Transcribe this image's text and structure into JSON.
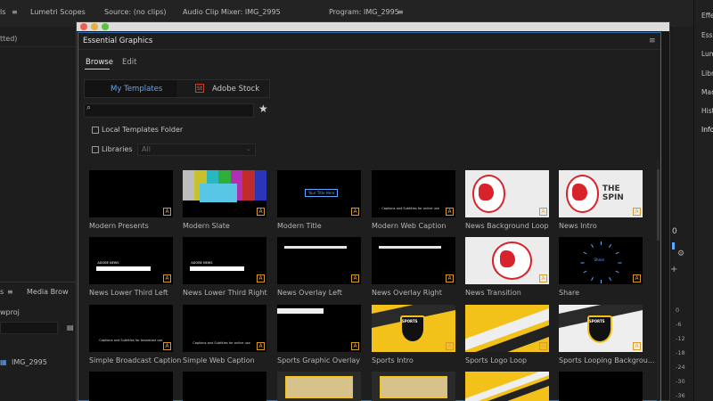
{
  "app": {
    "top_tabs": [
      "ls",
      "Lumetri Scopes",
      "Source: (no clips)",
      "Audio Clip Mixer: IMG_2995",
      "Program: IMG_2995"
    ],
    "left_text_1": "tted)",
    "right_tabs": [
      "Effe",
      "Essen",
      "Lum",
      "Libr",
      "Mar",
      "Hist",
      "Info"
    ],
    "bottom_left": {
      "tab": "Media Brow",
      "project": "wproj",
      "clip": "IMG_2995"
    },
    "meter_values": [
      "0",
      "-6",
      "-12",
      "-18",
      "-24",
      "-30",
      "-36"
    ]
  },
  "panel": {
    "title": "Essential Graphics",
    "tabs": [
      "Browse",
      "Edit"
    ],
    "segments": [
      "My Templates",
      "Adobe Stock"
    ],
    "stock_icon_text": "St",
    "search_placeholder": "",
    "local_templates_label": "Local Templates Folder",
    "libraries_label": "Libraries",
    "libraries_value": "All",
    "badge_text": "A"
  },
  "templates": [
    {
      "name": "Modern Presents",
      "style": "dark-text"
    },
    {
      "name": "Modern Slate",
      "style": "colorbars"
    },
    {
      "name": "Modern Title",
      "style": "title-box",
      "overlay": "Your Title Here"
    },
    {
      "name": "Modern Web Caption",
      "style": "caption",
      "overlay": "Captions and Subtitles for online use"
    },
    {
      "name": "News Background Loop",
      "style": "globe"
    },
    {
      "name": "News Intro",
      "style": "globe-spin",
      "overlay": "THE SPIN"
    },
    {
      "name": "News Lower Third Left",
      "style": "lower-third",
      "overlay": "ADOBE NEWS"
    },
    {
      "name": "News Lower Third Right",
      "style": "lower-third-right",
      "overlay": "ADOBE NEWS"
    },
    {
      "name": "News Overlay Left",
      "style": "overlay-left"
    },
    {
      "name": "News Overlay Right",
      "style": "overlay-right"
    },
    {
      "name": "News Transition",
      "style": "globe-big"
    },
    {
      "name": "Share",
      "style": "share",
      "overlay": "Share"
    },
    {
      "name": "Simple Broadcast Caption",
      "style": "caption-low",
      "overlay": "Captions and Subtitles for broadcast use"
    },
    {
      "name": "Simple Web Caption",
      "style": "caption-mid",
      "overlay": "Captions and Subtitles for online use"
    },
    {
      "name": "Sports Graphic Overlay",
      "style": "sports-overlay"
    },
    {
      "name": "Sports Intro",
      "style": "sports-yellow",
      "overlay": "SPORTS"
    },
    {
      "name": "Sports Logo Loop",
      "style": "sports-stripes"
    },
    {
      "name": "Sports Looping Backgrou...",
      "style": "sports-white",
      "overlay": "SPORTS"
    },
    {
      "name": "",
      "style": "dark-text"
    },
    {
      "name": "",
      "style": "dark-text"
    },
    {
      "name": "",
      "style": "sports-board"
    },
    {
      "name": "",
      "style": "sports-board"
    },
    {
      "name": "",
      "style": "sports-stripes"
    },
    {
      "name": "",
      "style": "dark-text"
    }
  ],
  "colors": {
    "accent": "#5aa8ff",
    "badge": "#d79a22",
    "sports_yellow": "#f2c21b",
    "news_red": "#d8232a"
  }
}
